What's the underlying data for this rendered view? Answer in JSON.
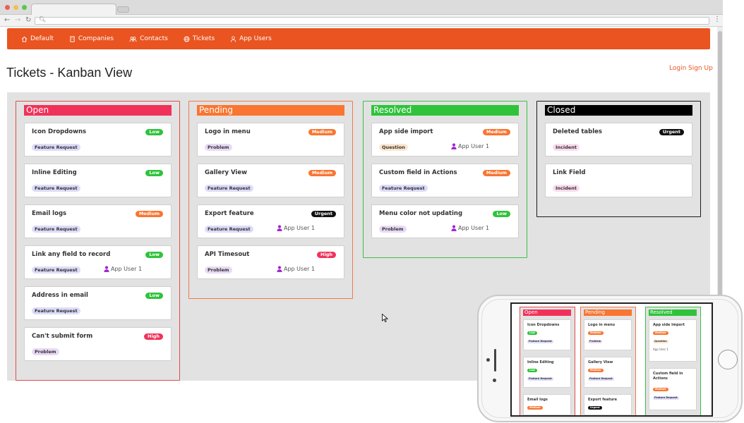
{
  "browser": {
    "url": "",
    "colors": {
      "close": "#ee5e54",
      "minimize": "#f5be4f",
      "maximize": "#58c84b"
    }
  },
  "navbar": {
    "items": [
      {
        "label": "Default",
        "icon": "home-icon"
      },
      {
        "label": "Companies",
        "icon": "building-icon"
      },
      {
        "label": "Contacts",
        "icon": "contacts-icon"
      },
      {
        "label": "Tickets",
        "icon": "globe-icon"
      },
      {
        "label": "App Users",
        "icon": "user-icon"
      }
    ],
    "color": "#e95420"
  },
  "page": {
    "title": "Tickets - Kanban View",
    "login": "Login",
    "signup": "Sign Up"
  },
  "kanban": {
    "columns": [
      {
        "name": "Open",
        "color": "#f0325a",
        "border": "#e34b4b",
        "cards": [
          {
            "title": "Icon Dropdowns",
            "priority": "Low",
            "category": "Feature Request",
            "assignee": ""
          },
          {
            "title": "Inline Editing",
            "priority": "Low",
            "category": "Feature Request",
            "assignee": ""
          },
          {
            "title": "Email logs",
            "priority": "Medium",
            "category": "Feature Request",
            "assignee": ""
          },
          {
            "title": "Link any field to record",
            "priority": "Low",
            "category": "Feature Request",
            "assignee": "App User 1"
          },
          {
            "title": "Address in email",
            "priority": "Low",
            "category": "Feature Request",
            "assignee": ""
          },
          {
            "title": "Can't submit form",
            "priority": "High",
            "category": "Problem",
            "assignee": ""
          }
        ]
      },
      {
        "name": "Pending",
        "color": "#f97531",
        "border": "#ef7a4a",
        "cards": [
          {
            "title": "Logo in menu",
            "priority": "Medium",
            "category": "Problem",
            "assignee": ""
          },
          {
            "title": "Gallery View",
            "priority": "Medium",
            "category": "Feature Request",
            "assignee": ""
          },
          {
            "title": "Export feature",
            "priority": "Urgent",
            "category": "Feature Request",
            "assignee": "App User 1"
          },
          {
            "title": "API Timesout",
            "priority": "High",
            "category": "Problem",
            "assignee": "App User 1"
          }
        ]
      },
      {
        "name": "Resolved",
        "color": "#2fc33b",
        "border": "#3cc04a",
        "cards": [
          {
            "title": "App side import",
            "priority": "Medium",
            "category": "Question",
            "assignee": "App User 1"
          },
          {
            "title": "Custom field in Actions",
            "priority": "Medium",
            "category": "Feature Request",
            "assignee": ""
          },
          {
            "title": "Menu color not updating",
            "priority": "Low",
            "category": "Problem",
            "assignee": "App User 1"
          }
        ]
      },
      {
        "name": "Closed",
        "color": "#000000",
        "border": "#1a1a1a",
        "cards": [
          {
            "title": "Deleted tables",
            "priority": "Urgent",
            "category": "Incident",
            "assignee": ""
          },
          {
            "title": "Link Field",
            "priority": "",
            "category": "Incident",
            "assignee": ""
          }
        ]
      }
    ],
    "priority_colors": {
      "Low": "#2fc33b",
      "Medium": "#f97531",
      "High": "#f0325a",
      "Urgent": "#111111"
    },
    "category_colors": {
      "Feature Request": "#dcdcfa",
      "Problem": "#e8daf5",
      "Question": "#fbe7cf",
      "Incident": "#fbdcef"
    },
    "assignee_icon_color": "#a11fd1"
  },
  "phone_preview": {
    "columns": [
      {
        "name": "Open",
        "cards": [
          {
            "title": "Icon Dropdowns",
            "priority": "Low",
            "category": "Feature Request",
            "assignee": ""
          },
          {
            "title": "Inline Editing",
            "priority": "Low",
            "category": "Feature Request",
            "assignee": ""
          },
          {
            "title": "Email logs",
            "priority": "Medium",
            "category": "",
            "assignee": ""
          }
        ]
      },
      {
        "name": "Pending",
        "cards": [
          {
            "title": "Logo in menu",
            "priority": "Medium",
            "category": "Problem",
            "assignee": ""
          },
          {
            "title": "Gallery View",
            "priority": "Medium",
            "category": "Feature Request",
            "assignee": ""
          },
          {
            "title": "Export feature",
            "priority": "Urgent",
            "category": "",
            "assignee": ""
          }
        ]
      },
      {
        "name": "Resolved",
        "cards": [
          {
            "title": "App side import",
            "priority": "Medium",
            "category": "Question",
            "assignee": "App User 1"
          },
          {
            "title": "Custom field in Actions",
            "priority": "Medium",
            "category": "Feature Request",
            "assignee": ""
          }
        ]
      }
    ]
  }
}
